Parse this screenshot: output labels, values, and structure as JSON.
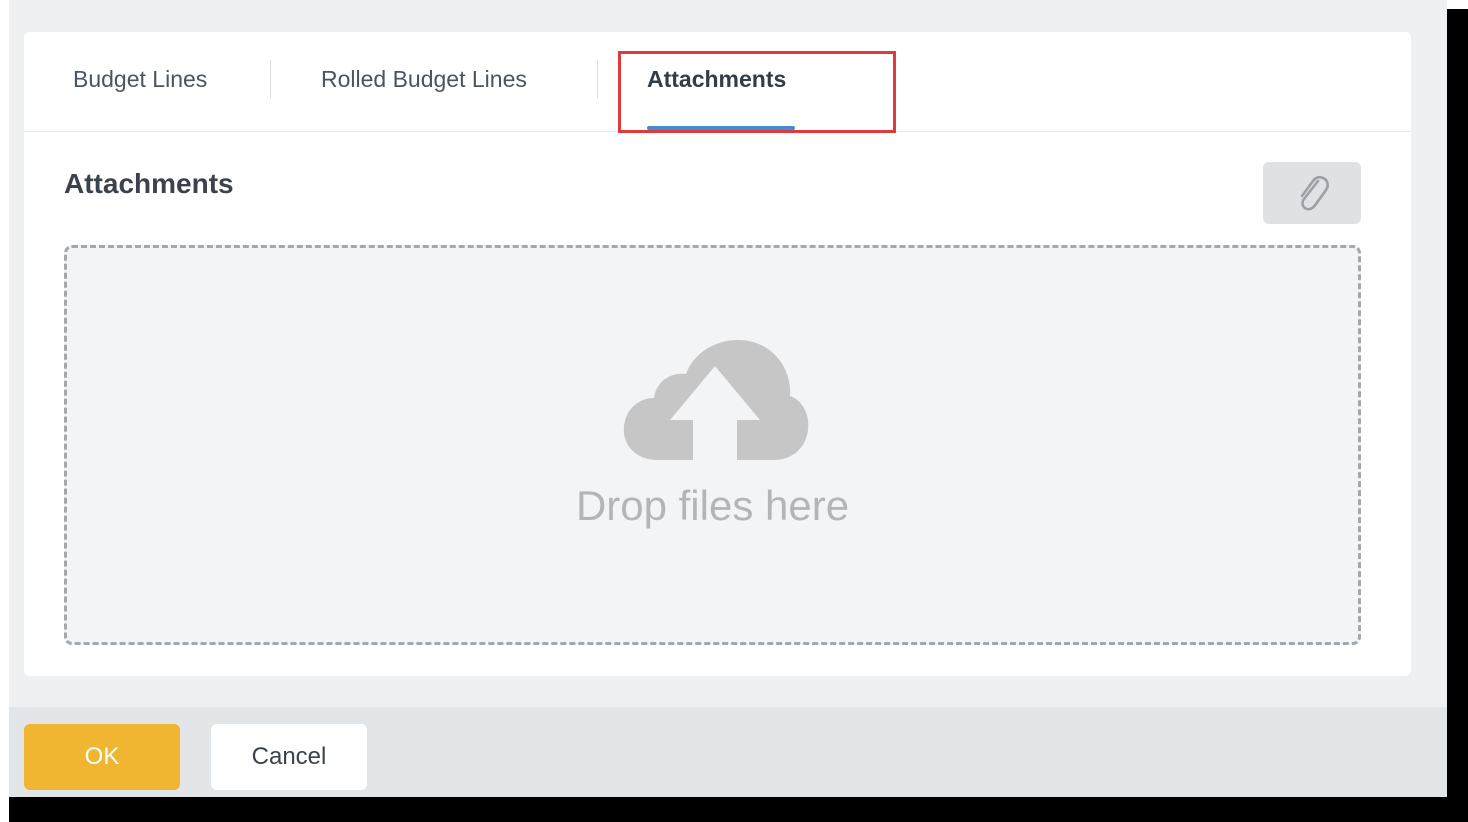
{
  "tabs": [
    {
      "label": "Budget Lines"
    },
    {
      "label": "Rolled Budget Lines"
    },
    {
      "label": "Attachments",
      "active": true
    }
  ],
  "attachments": {
    "title": "Attachments",
    "attach_icon": "paperclip-icon",
    "dropzone_icon": "cloud-upload-icon",
    "dropzone_text": "Drop files here"
  },
  "footer": {
    "ok_label": "OK",
    "cancel_label": "Cancel"
  },
  "colors": {
    "accent_tab": "#3d8fd1",
    "highlight": "#e0393e",
    "ok_button": "#f0b531"
  }
}
